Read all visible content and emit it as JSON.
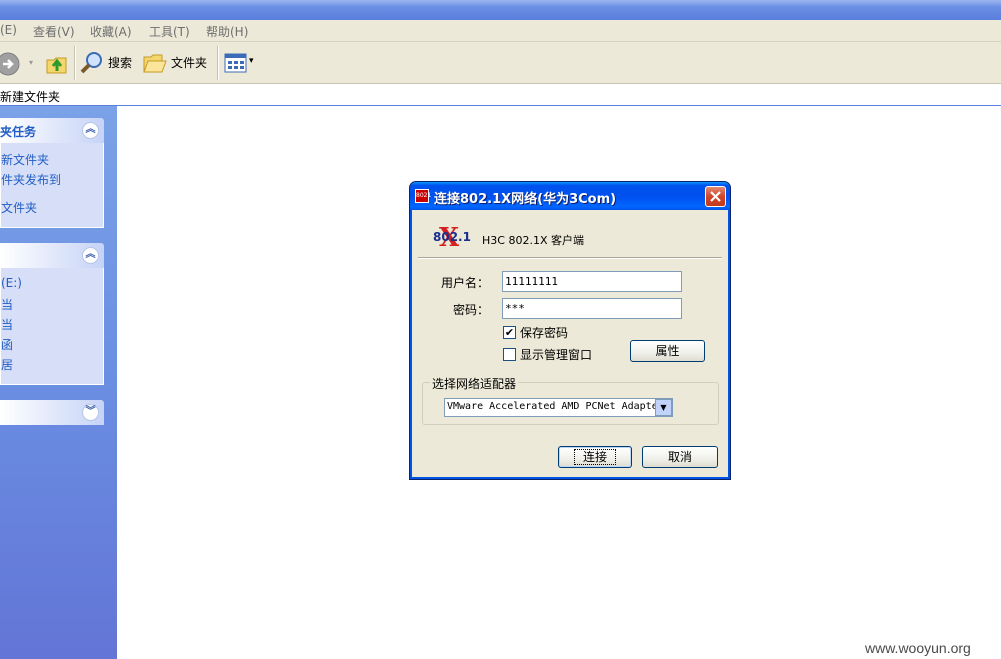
{
  "menubar": {
    "items": [
      "(E)",
      "查看(V)",
      "收藏(A)",
      "工具(T)",
      "帮助(H)"
    ]
  },
  "toolbar": {
    "search_label": "搜索",
    "folders_label": "文件夹"
  },
  "address": {
    "text": "新建文件夹"
  },
  "task_panes": {
    "pane1": {
      "title": "夹任务",
      "links": [
        "新文件夹",
        "件夹发布到",
        "文件夹"
      ]
    },
    "pane2": {
      "title": "",
      "links": [
        "(E:)",
        "当",
        "当",
        "函",
        "居"
      ]
    },
    "pane3": {
      "title": ""
    }
  },
  "dialog": {
    "title": "连接802.1X网络(华为3Com)",
    "logo_text": "802.1",
    "logo_letter": "X",
    "client_name": "H3C 802.1X 客户端",
    "username_label": "用户名：",
    "username_value": "11111111",
    "password_label": "密码：",
    "password_value": "***",
    "save_password_label": "保存密码",
    "save_password_checked": "✔",
    "show_admin_label": "显示管理窗口",
    "properties_button": "属性",
    "adapter_group_label": "选择网络适配器",
    "adapter_selected": "VMware Accelerated AMD PCNet Adapter",
    "connect_button": "连接",
    "cancel_button": "取消"
  },
  "watermark": "www.wooyun.org"
}
